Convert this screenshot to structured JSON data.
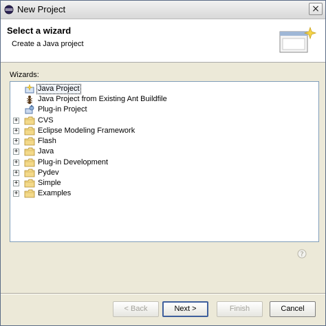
{
  "window": {
    "title": "New Project"
  },
  "banner": {
    "title": "Select a wizard",
    "subtitle": "Create a Java project"
  },
  "wizards": {
    "label": "Wizards:",
    "items": [
      {
        "label": "Java Project",
        "icon": "java-project-icon",
        "expandable": false,
        "selected": true
      },
      {
        "label": "Java Project from Existing Ant Buildfile",
        "icon": "ant-buildfile-icon",
        "expandable": false,
        "selected": false
      },
      {
        "label": "Plug-in Project",
        "icon": "plugin-project-icon",
        "expandable": false,
        "selected": false
      },
      {
        "label": "CVS",
        "icon": "folder-icon",
        "expandable": true,
        "selected": false
      },
      {
        "label": "Eclipse Modeling Framework",
        "icon": "folder-icon",
        "expandable": true,
        "selected": false
      },
      {
        "label": "Flash",
        "icon": "folder-icon",
        "expandable": true,
        "selected": false
      },
      {
        "label": "Java",
        "icon": "folder-icon",
        "expandable": true,
        "selected": false
      },
      {
        "label": "Plug-in Development",
        "icon": "folder-icon",
        "expandable": true,
        "selected": false
      },
      {
        "label": "Pydev",
        "icon": "folder-icon",
        "expandable": true,
        "selected": false
      },
      {
        "label": "Simple",
        "icon": "folder-icon",
        "expandable": true,
        "selected": false
      },
      {
        "label": "Examples",
        "icon": "folder-icon",
        "expandable": true,
        "selected": false
      }
    ],
    "expand_symbol": "+"
  },
  "help": {
    "symbol": "?"
  },
  "buttons": {
    "back": "< Back",
    "next": "Next >",
    "finish": "Finish",
    "cancel": "Cancel"
  },
  "close_symbol": "×",
  "colors": {
    "selection_border": "#000000",
    "tree_border": "#7f9db9",
    "folder": "#e9c25b"
  }
}
